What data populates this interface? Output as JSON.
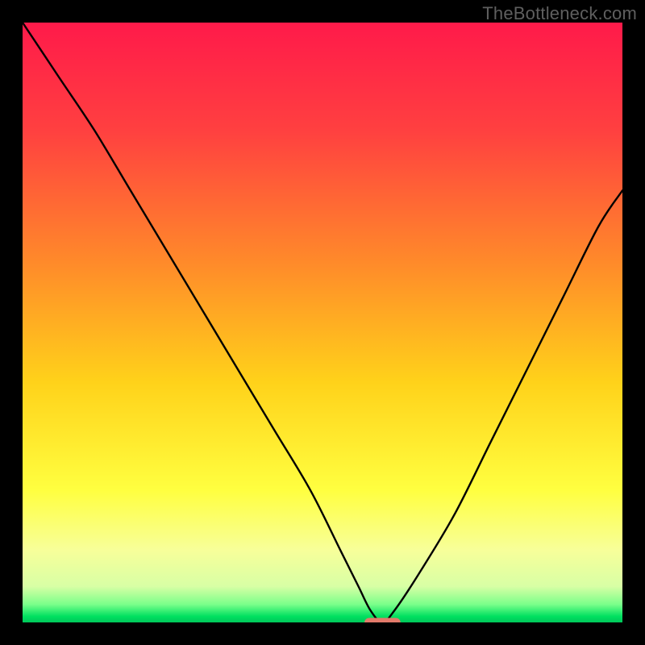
{
  "watermark": "TheBottleneck.com",
  "chart_data": {
    "type": "line",
    "title": "",
    "xlabel": "",
    "ylabel": "",
    "xlim": [
      0,
      100
    ],
    "ylim": [
      0,
      100
    ],
    "background_gradient_stops": [
      {
        "offset": 0.0,
        "color": "#ff1a4a"
      },
      {
        "offset": 0.18,
        "color": "#ff4040"
      },
      {
        "offset": 0.4,
        "color": "#ff8a2a"
      },
      {
        "offset": 0.6,
        "color": "#ffd21a"
      },
      {
        "offset": 0.78,
        "color": "#ffff40"
      },
      {
        "offset": 0.88,
        "color": "#f7ff9a"
      },
      {
        "offset": 0.94,
        "color": "#d8ffa5"
      },
      {
        "offset": 0.97,
        "color": "#7aff8a"
      },
      {
        "offset": 0.99,
        "color": "#00e060"
      },
      {
        "offset": 1.0,
        "color": "#00c75a"
      }
    ],
    "series": [
      {
        "name": "bottleneck-curve",
        "x": [
          0,
          6,
          12,
          18,
          24,
          30,
          36,
          42,
          48,
          53,
          56,
          58,
          60,
          62,
          66,
          72,
          78,
          84,
          90,
          96,
          100
        ],
        "y": [
          100,
          91,
          82,
          72,
          62,
          52,
          42,
          32,
          22,
          12,
          6,
          2,
          0,
          2,
          8,
          18,
          30,
          42,
          54,
          66,
          72
        ]
      }
    ],
    "marker": {
      "name": "optimal-point",
      "x": 60,
      "y": 0,
      "width": 6,
      "height": 1.5,
      "color": "#e27a6a"
    }
  }
}
